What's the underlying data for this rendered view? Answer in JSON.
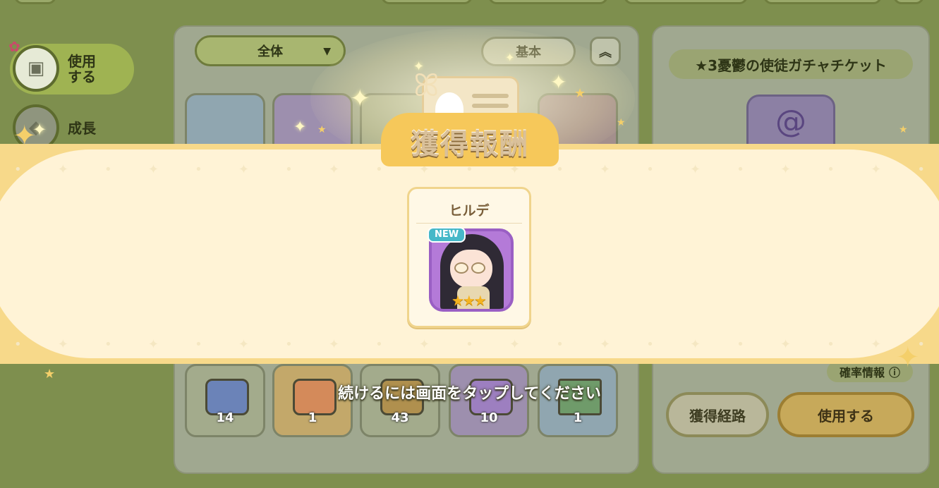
{
  "sidebar": {
    "items": [
      {
        "label_line1": "使用",
        "label_line2": "する",
        "icon": "chest-icon",
        "active": true
      },
      {
        "label": "成長",
        "icon": "growth-icon",
        "active": false
      }
    ]
  },
  "inventory": {
    "filter_value": "全体",
    "sort_value": "基本",
    "sort_order_symbol": "⏫",
    "items": [
      {
        "name": "blue-chest",
        "count": "14",
        "color": "#6b83b8"
      },
      {
        "name": "red-chest",
        "count": "1",
        "color": "#d48a5a"
      },
      {
        "name": "brown-chest",
        "count": "43",
        "color": "#b0904e"
      },
      {
        "name": "purple-chest",
        "count": "10",
        "color": "#9d7fc0"
      },
      {
        "name": "green-ticket",
        "count": "1",
        "color": "#6f9bb3"
      }
    ]
  },
  "detail": {
    "item_title": "★3憂鬱の使徒ガチャチケット",
    "probability_label": "確率情報",
    "route_button": "獲得経路",
    "use_button": "使用する"
  },
  "reward_modal": {
    "title": "獲得報酬",
    "reward_name": "ヒルデ",
    "new_badge": "NEW",
    "rarity_stars": "★★★",
    "tap_hint": "続けるには画面をタップしてください"
  },
  "colors": {
    "banner": "#f7d98a",
    "banner_inner": "#fff3d6",
    "thumb_purple": "#b47ad8",
    "badge_teal": "#46b8c8",
    "star_gold": "#f5b31f"
  }
}
